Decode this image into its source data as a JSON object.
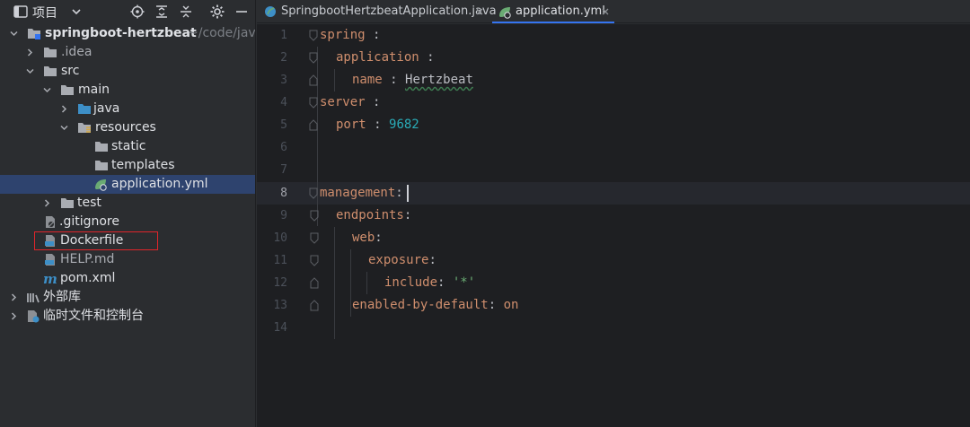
{
  "project_panel": {
    "title": "项目",
    "tree": [
      {
        "label": "springboot-hertzbeat",
        "path_hint": "~/code/java"
      },
      {
        "label": ".idea"
      },
      {
        "label": "src"
      },
      {
        "label": "main"
      },
      {
        "label": "java"
      },
      {
        "label": "resources"
      },
      {
        "label": "static"
      },
      {
        "label": "templates"
      },
      {
        "label": "application.yml"
      },
      {
        "label": "test"
      },
      {
        "label": ".gitignore"
      },
      {
        "label": "Dockerfile"
      },
      {
        "label": "HELP.md"
      },
      {
        "label": "pom.xml"
      },
      {
        "label": "外部库"
      },
      {
        "label": "临时文件和控制台"
      }
    ]
  },
  "tabs": [
    {
      "label": "SpringbootHertzbeatApplication.java",
      "active": false
    },
    {
      "label": "application.yml",
      "active": true
    }
  ],
  "editor": {
    "current_line": 8,
    "lines": [
      {
        "n": "1",
        "key": "spring",
        "sep": " :",
        "val": ""
      },
      {
        "n": "2",
        "key": "application",
        "sep": " :",
        "val": ""
      },
      {
        "n": "3",
        "key": "name",
        "sep": " : ",
        "val": "Hertzbeat"
      },
      {
        "n": "4",
        "key": "server",
        "sep": " :",
        "val": ""
      },
      {
        "n": "5",
        "key": "port",
        "sep": " : ",
        "val": "9682"
      },
      {
        "n": "6",
        "key": "",
        "sep": "",
        "val": ""
      },
      {
        "n": "7",
        "key": "",
        "sep": "",
        "val": ""
      },
      {
        "n": "8",
        "key": "management",
        "sep": ":",
        "val": ""
      },
      {
        "n": "9",
        "key": "endpoints",
        "sep": ":",
        "val": ""
      },
      {
        "n": "10",
        "key": "web",
        "sep": ":",
        "val": ""
      },
      {
        "n": "11",
        "key": "exposure",
        "sep": ":",
        "val": ""
      },
      {
        "n": "12",
        "key": "include",
        "sep": ": ",
        "val": "'*'"
      },
      {
        "n": "13",
        "key": "enabled-by-default",
        "sep": ": ",
        "val": "on"
      },
      {
        "n": "14",
        "key": "",
        "sep": "",
        "val": ""
      }
    ]
  },
  "colors": {
    "accent": "#3574f0",
    "selection": "#2e436e",
    "highlight_box": "#e0252a",
    "yaml_key": "#cf8e6d",
    "yaml_number": "#2aacb8",
    "yaml_string": "#6aab73"
  }
}
